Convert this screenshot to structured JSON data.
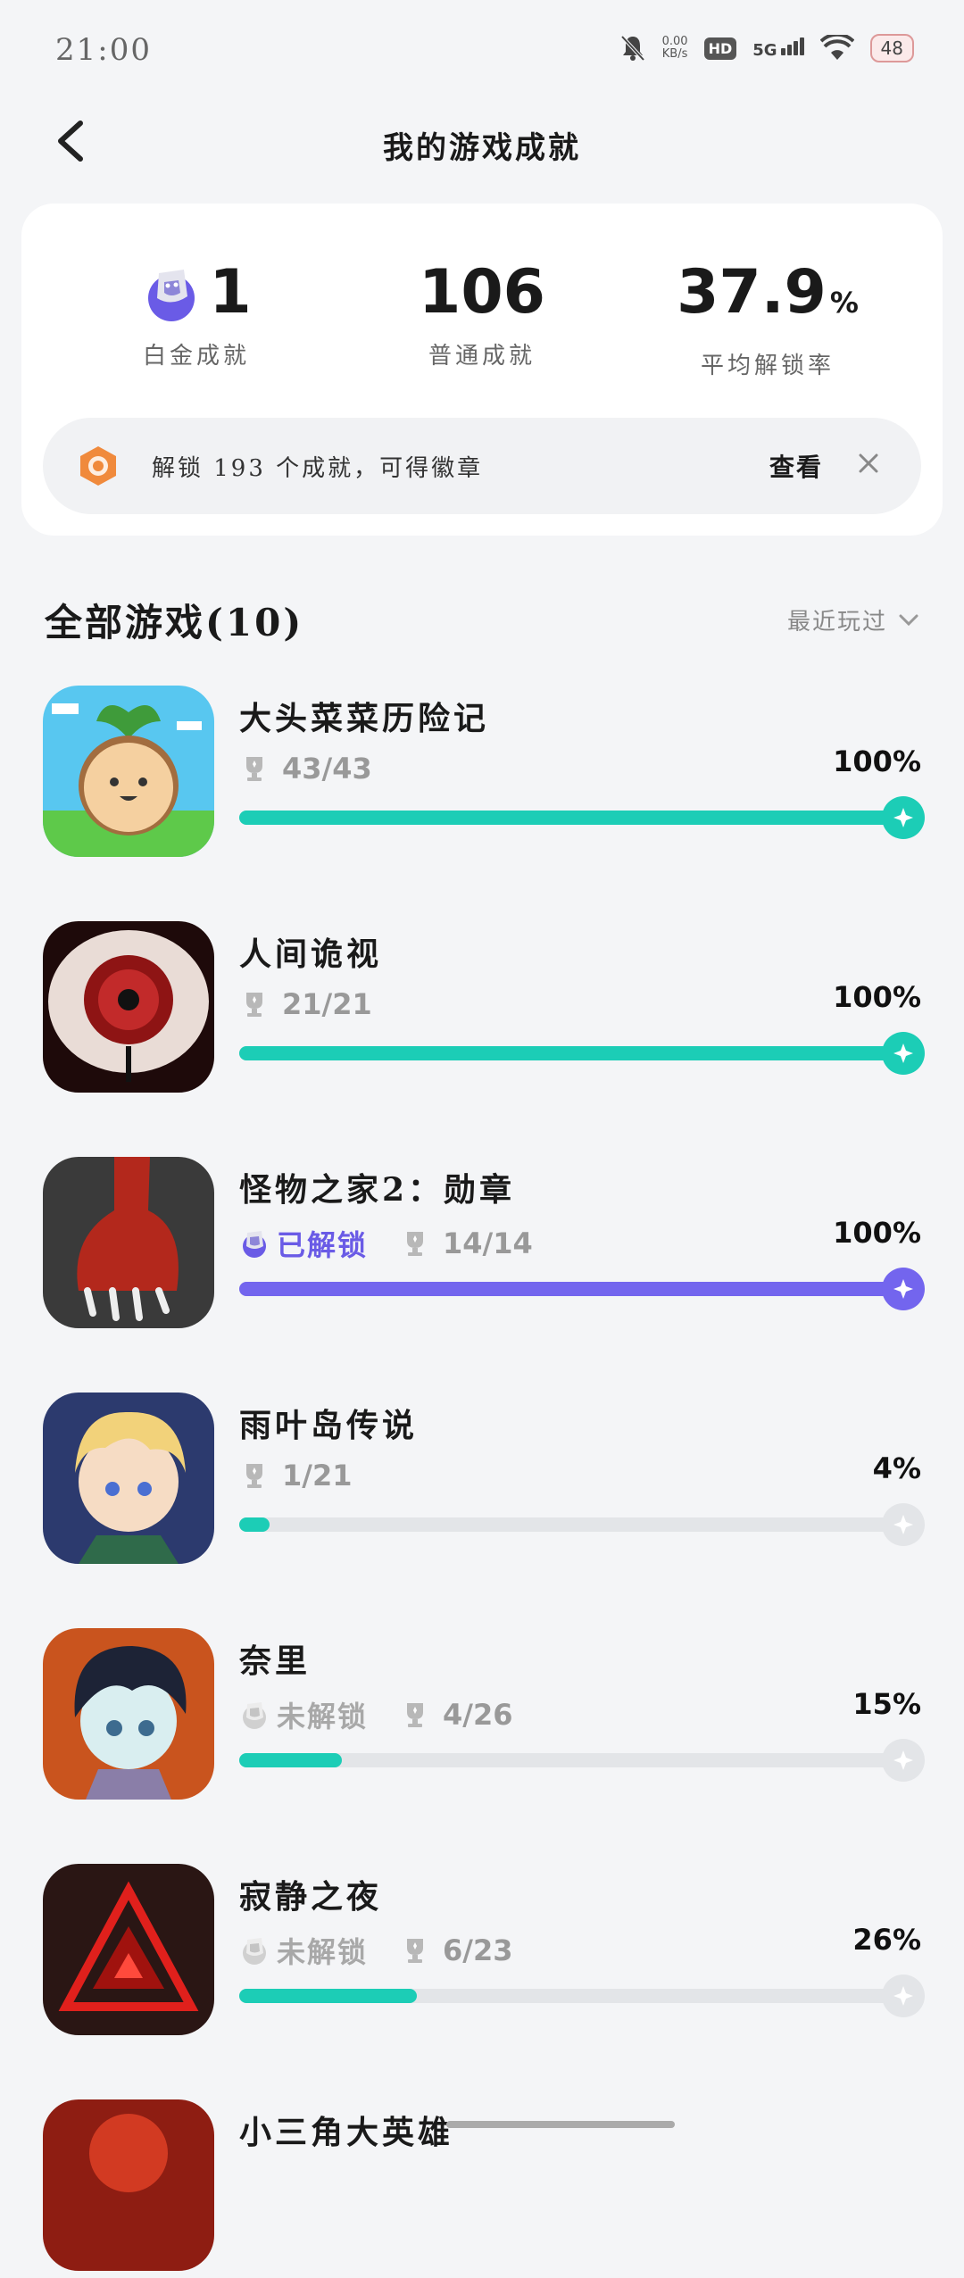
{
  "status_bar": {
    "time": "21:00",
    "net_speed_value": "0.00",
    "net_speed_unit": "KB/s",
    "hd_label": "HD",
    "network_label": "5G",
    "battery": "48"
  },
  "header": {
    "title": "我的游戏成就"
  },
  "summary": {
    "platinum": {
      "value": "1",
      "label": "白金成就"
    },
    "normal": {
      "value": "106",
      "label": "普通成就"
    },
    "rate": {
      "value": "37.9",
      "unit": "%",
      "label": "平均解锁率"
    }
  },
  "banner": {
    "text": "解锁 193 个成就，可得徽章",
    "view_label": "查看"
  },
  "list": {
    "title": "全部游戏(10)",
    "sort_label": "最近玩过"
  },
  "games": [
    {
      "name": "大头菜菜历险记",
      "platinum_status": "",
      "count": "43/43",
      "percent_text": "100%",
      "progress": 1.0,
      "color": "#1ccdb6"
    },
    {
      "name": "人间诡视",
      "platinum_status": "",
      "count": "21/21",
      "percent_text": "100%",
      "progress": 1.0,
      "color": "#1ccdb6"
    },
    {
      "name": "怪物之家2：勋章",
      "platinum_status": "已解锁",
      "count": "14/14",
      "percent_text": "100%",
      "progress": 1.0,
      "color": "#7365ee"
    },
    {
      "name": "雨叶岛传说",
      "platinum_status": "",
      "count": "1/21",
      "percent_text": "4%",
      "progress": 0.04,
      "color": "#1ccdb6"
    },
    {
      "name": "奈里",
      "platinum_status": "未解锁",
      "count": "4/26",
      "percent_text": "15%",
      "progress": 0.15,
      "color": "#1ccdb6"
    },
    {
      "name": "寂静之夜",
      "platinum_status": "未解锁",
      "count": "6/23",
      "percent_text": "26%",
      "progress": 0.26,
      "color": "#1ccdb6"
    },
    {
      "name": "小三角大英雄",
      "platinum_status": "",
      "count": "",
      "percent_text": "",
      "progress": 0,
      "color": "#1ccdb6"
    }
  ],
  "colors": {
    "teal": "#1ccdb6",
    "purple": "#7365ee",
    "track": "#e3e5e8",
    "badge_orange": "#f08a3c"
  }
}
